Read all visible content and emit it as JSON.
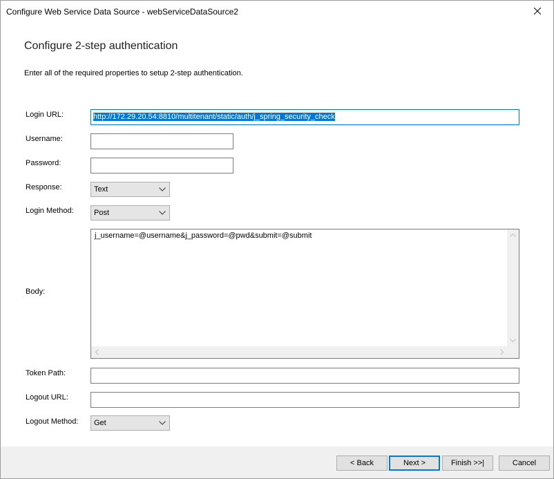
{
  "window": {
    "title": "Configure Web Service Data Source - webServiceDataSource2"
  },
  "page": {
    "heading": "Configure 2-step authentication",
    "description": "Enter all of the required properties to setup 2-step authentication."
  },
  "form": {
    "login_url_label": "Login URL:",
    "login_url_value": "http://172.29.20.54:8810/multitenant/static/auth/j_spring_security_check",
    "username_label": "Username:",
    "username_value": "",
    "password_label": "Password:",
    "password_value": "",
    "response_label": "Response:",
    "response_value": "Text",
    "login_method_label": "Login Method:",
    "login_method_value": "Post",
    "body_label": "Body:",
    "body_value": "j_username=@username&j_password=@pwd&submit=@submit",
    "token_path_label": "Token Path:",
    "token_path_value": "",
    "logout_url_label": "Logout URL:",
    "logout_url_value": "",
    "logout_method_label": "Logout Method:",
    "logout_method_value": "Get"
  },
  "buttons": {
    "back": "< Back",
    "next": "Next >",
    "finish": "Finish >>|",
    "cancel": "Cancel"
  }
}
